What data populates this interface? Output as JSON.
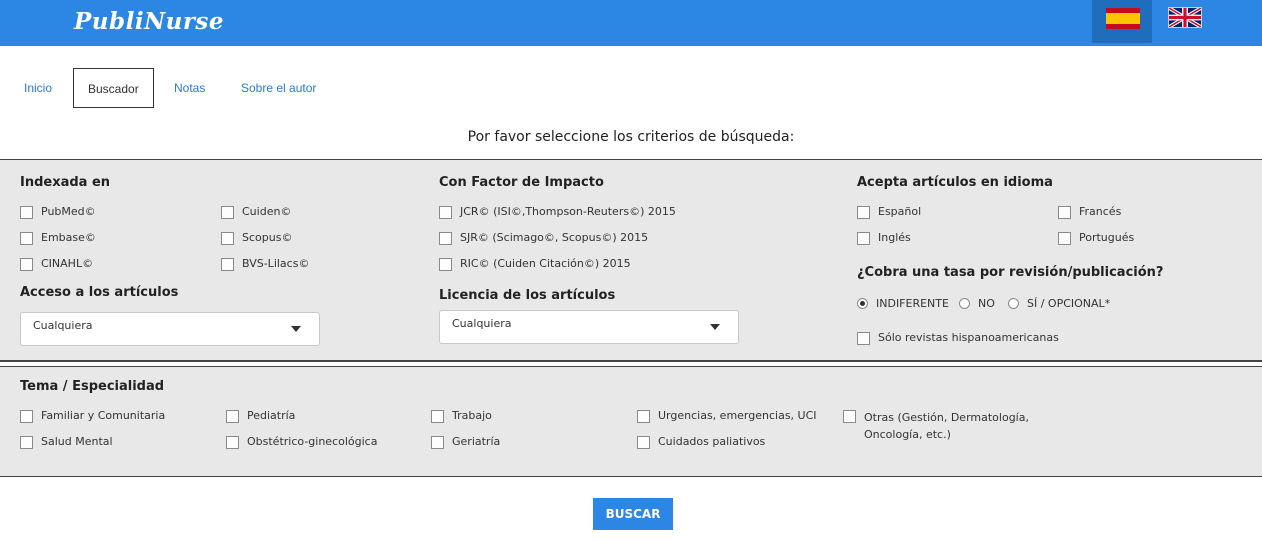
{
  "header": {
    "logo": "PubliNurse",
    "flags": [
      "es-flag-icon",
      "uk-flag-icon"
    ],
    "accent": "#2b87e3"
  },
  "nav": [
    {
      "label": "Inicio"
    },
    {
      "label": "Buscador",
      "active": true
    },
    {
      "label": "Notas"
    },
    {
      "label": "Sobre el autor"
    }
  ],
  "prompt": "Por favor seleccione los criterios de búsqueda:",
  "indexed": {
    "heading": "Indexada en",
    "options": [
      "PubMed©",
      "Cuiden©",
      "Embase©",
      "Scopus©",
      "CINAHL©",
      "BVS-Lilacs©"
    ]
  },
  "impact": {
    "heading": "Con Factor de Impacto",
    "options": [
      "JCR© (ISI©,Thompson-Reuters©) 2015",
      "SJR© (Scimago©, Scopus©) 2015",
      "RIC© (Cuiden Citación©) 2015"
    ]
  },
  "language": {
    "heading": "Acepta artículos en idioma",
    "options": [
      "Español",
      "Francés",
      "Inglés",
      "Portugués"
    ]
  },
  "access": {
    "heading": "Acceso a los artículos",
    "value": "Cualquiera"
  },
  "license": {
    "heading": "Licencia de los artículos",
    "value": "Cualquiera"
  },
  "fee": {
    "heading": "¿Cobra una tasa por revisión/publicación?",
    "options": [
      "INDIFERENTE",
      "NO",
      "SÍ / OPCIONAL*"
    ],
    "selected": "INDIFERENTE",
    "hispanic_only": "Sólo revistas hispanoamericanas"
  },
  "topic": {
    "heading": "Tema / Especialidad",
    "options": [
      "Familiar y Comunitaria",
      "Pediatría",
      "Trabajo",
      "Urgencias, emergencias, UCI",
      "Otras (Gestión, Dermatología,",
      "Oncología, etc.)",
      "Salud Mental",
      "Obstétrico-ginecológica",
      "Geriatría",
      "Cuidados paliativos"
    ]
  },
  "search_button": "BUSCAR"
}
